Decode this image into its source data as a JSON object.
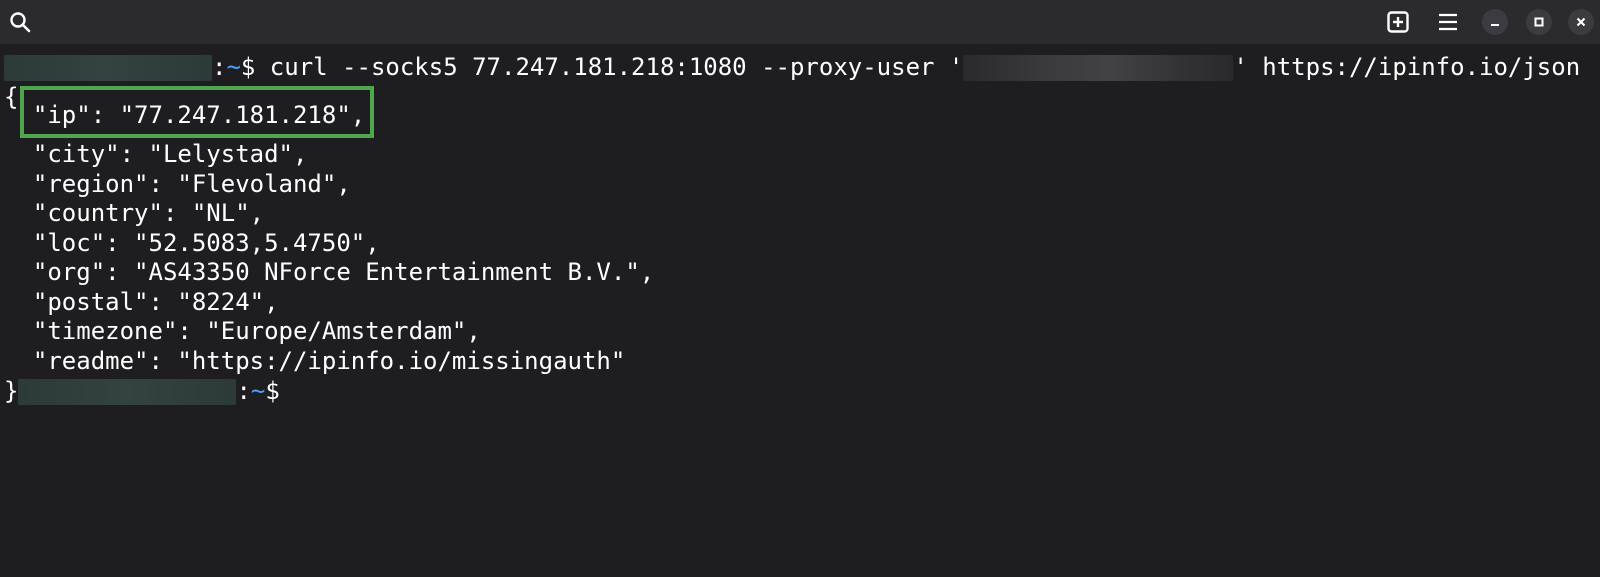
{
  "titlebar": {
    "icons": [
      "search-icon",
      "new-tab-icon",
      "hamburger-menu-icon",
      "minimize-icon",
      "maximize-icon",
      "close-icon"
    ]
  },
  "terminal": {
    "prompt1": {
      "separator": ":",
      "tilde": "~",
      "dollar": "$",
      "command_part1": " curl --socks5 77.247.181.218:1080 --proxy-user '",
      "command_part2": "' https://ipinfo.io/json"
    },
    "output": [
      "{",
      "  \"ip\": \"77.247.181.218\",",
      "  \"city\": \"Lelystad\",",
      "  \"region\": \"Flevoland\",",
      "  \"country\": \"NL\",",
      "  \"loc\": \"52.5083,5.4750\",",
      "  \"org\": \"AS43350 NForce Entertainment B.V.\",",
      "  \"postal\": \"8224\",",
      "  \"timezone\": \"Europe/Amsterdam\",",
      "  \"readme\": \"https://ipinfo.io/missingauth\""
    ],
    "prompt2": {
      "brace": "}",
      "separator": ":",
      "tilde": "~",
      "dollar": "$"
    },
    "highlight_color": "#4ea64e",
    "prompt_path_color": "#4a9fff"
  }
}
